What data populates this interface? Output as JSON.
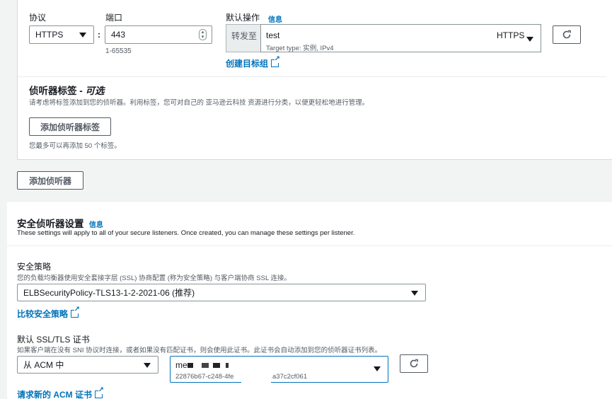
{
  "listener": {
    "protocol_label": "协议",
    "protocol_value": "HTTPS",
    "colon": ":",
    "port_label": "端口",
    "port_value": "443",
    "port_hint": "1-65535",
    "default_action_label": "默认操作",
    "info_link": "信息",
    "forward_to": "转发至",
    "target_name": "test",
    "target_type": "Target type: 实例, IPv4",
    "target_protocol": "HTTPS",
    "create_target_group": "创建目标组"
  },
  "tags": {
    "title": "侦听器标签 - ",
    "title_optional": "可选",
    "description": "请考虑将标签添加到您的侦听器。利用标签，您可对自己的 亚马逊云科技 资源进行分类，以便更轻松地进行管理。",
    "add_button": "添加侦听器标签",
    "limit_hint": "您最多可以再添加 50 个标签。"
  },
  "add_listener_button": "添加侦听器",
  "secure": {
    "title": "安全侦听器设置",
    "info_link": "信息",
    "description": "These settings will apply to all of your secure listeners. Once created, you can manage these settings per listener.",
    "policy_label": "安全策略",
    "policy_description": "您的负载均衡器使用安全套接字层 (SSL) 协商配置 (称为安全策略) 与客户端协商 SSL 连接。",
    "policy_value": "ELBSecurityPolicy-TLS13-1-2-2021-06 (推荐)",
    "compare_link": "比较安全策略",
    "cert_label": "默认 SSL/TLS 证书",
    "cert_description": "如果客户端在没有 SNI 协议时连接，或者如果没有匹配证书，则会使用此证书。此证书会自动添加到您的侦听器证书列表。",
    "cert_source": "从 ACM 中",
    "cert_name": "me",
    "cert_id_left": "22876b67-c248-4fe",
    "cert_id_right": "a37c2cf061",
    "request_link": "请求新的 ACM 证书"
  }
}
